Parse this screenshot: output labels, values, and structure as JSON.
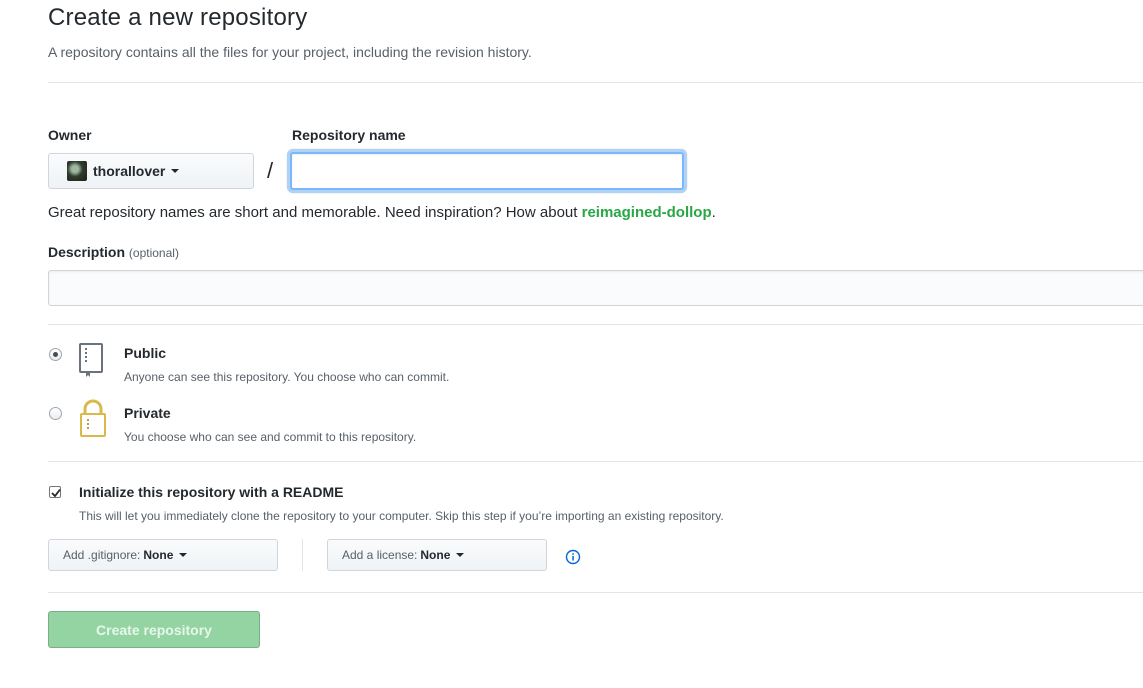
{
  "header": {
    "title": "Create a new repository",
    "subtitle": "A repository contains all the files for your project, including the revision history."
  },
  "owner": {
    "label": "Owner",
    "selected": "thorallover"
  },
  "repo_name": {
    "label": "Repository name",
    "separator": "/",
    "value": "",
    "hint_prefix": "Great repository names are short and memorable. Need inspiration? How about ",
    "suggestion": "reimagined-dollop",
    "hint_suffix": "."
  },
  "description": {
    "label": "Description",
    "optional": "(optional)",
    "value": ""
  },
  "visibility": {
    "selected": "public",
    "options": [
      {
        "id": "public",
        "title": "Public",
        "desc": "Anyone can see this repository. You choose who can commit.",
        "icon": "book-icon"
      },
      {
        "id": "private",
        "title": "Private",
        "desc": "You choose who can see and commit to this repository.",
        "icon": "lock-icon"
      }
    ]
  },
  "readme": {
    "checked": true,
    "label": "Initialize this repository with a README",
    "desc": "This will let you immediately clone the repository to your computer. Skip this step if you’re importing an existing repository."
  },
  "gitignore": {
    "label": "Add .gitignore:",
    "value": "None"
  },
  "license": {
    "label": "Add a license:",
    "value": "None"
  },
  "submit": {
    "label": "Create repository",
    "disabled": true
  },
  "colors": {
    "text": "#24292e",
    "muted": "#586069",
    "suggestion_green": "#28a745",
    "create_button_disabled": "#94d3a2",
    "info_blue": "#0366d6",
    "focus_border": "#79b8ff"
  }
}
